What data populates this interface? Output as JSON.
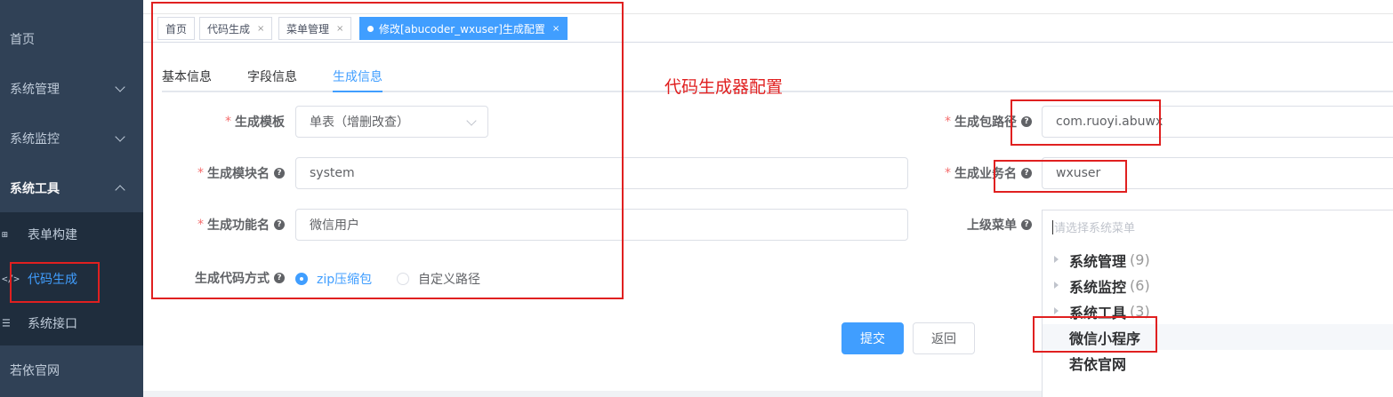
{
  "sidebar": {
    "items": [
      {
        "label": "首页"
      },
      {
        "label": "系统管理"
      },
      {
        "label": "系统监控"
      },
      {
        "label": "系统工具"
      },
      {
        "label": "若依官网"
      }
    ],
    "sub_items": [
      {
        "label": "表单构建",
        "icon": "⊞"
      },
      {
        "label": "代码生成",
        "icon": "</>"
      },
      {
        "label": "系统接口",
        "icon": "☰"
      }
    ]
  },
  "tags": [
    {
      "label": "首页"
    },
    {
      "label": "代码生成",
      "close": "×"
    },
    {
      "label": "菜单管理",
      "close": "×"
    },
    {
      "label": "修改[abucoder_wxuser]生成配置",
      "close": "×"
    }
  ],
  "tabs": [
    "基本信息",
    "字段信息",
    "生成信息"
  ],
  "annotation": "代码生成器配置",
  "form": {
    "tpl_label": "生成模板",
    "tpl_value": "单表（增删改查）",
    "module_label": "生成模块名",
    "module_value": "system",
    "function_label": "生成功能名",
    "function_value": "微信用户",
    "gentype_label": "生成代码方式",
    "radio_zip": "zip压缩包",
    "radio_custom": "自定义路径",
    "package_label": "生成包路径",
    "package_value": "com.ruoyi.abuwx",
    "business_label": "生成业务名",
    "business_value": "wxuser",
    "parent_label": "上级菜单",
    "parent_placeholder": "请选择系统菜单",
    "required_mark": "*",
    "help_mark": "?"
  },
  "tree": [
    {
      "label": "系统管理",
      "count": "(9)"
    },
    {
      "label": "系统监控",
      "count": "(6)"
    },
    {
      "label": "系统工具",
      "count": "(3)"
    },
    {
      "label": "微信小程序",
      "count": ""
    },
    {
      "label": "若依官网",
      "count": ""
    }
  ],
  "buttons": {
    "submit": "提交",
    "back": "返回"
  },
  "colors": {
    "primary": "#409eff",
    "sidebar": "#304156",
    "annotation": "#e02020",
    "required": "#f56c6c"
  }
}
